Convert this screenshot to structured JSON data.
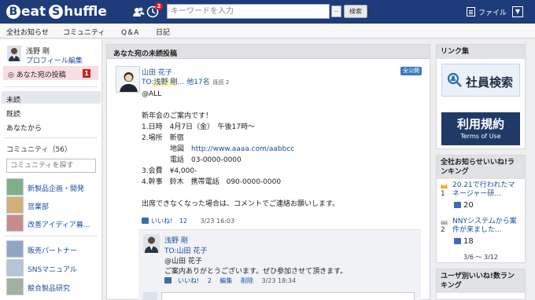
{
  "header": {
    "logo_part1": "eat",
    "logo_cap1": "B",
    "logo_cap2": "S",
    "logo_part2": "huffle",
    "notifications_count": "2",
    "search_placeholder": "キーワードを入力",
    "search_scope": "--",
    "search_button": "検索",
    "file_menu": "ファイル",
    "user_menu_arrow": "▼"
  },
  "nav": {
    "tabs": [
      "全社お知らせ",
      "コミュニティ",
      "Q＆A",
      "日記"
    ]
  },
  "sidebar": {
    "user_name": "浅野 剛",
    "profile_edit": "プロフィール編集",
    "unread_label": "◎ あなた宛の投稿",
    "unread_count": "1",
    "filters": [
      "未読",
      "既読",
      "あなたから"
    ],
    "community_heading": "コミュニティ（56）",
    "community_search_placeholder": "コミュニティを探す",
    "communities": [
      "新製品企画・開発",
      "営業部",
      "改善アイディア募...",
      "販売パートナー",
      "SNSマニュアル",
      "競合製品研究"
    ]
  },
  "main": {
    "title": "あなた宛の未読投稿",
    "post": {
      "author": "山田 花子",
      "to_prefix": "TO:",
      "to_name": "浅野 剛",
      "to_others": "… 他17名",
      "read_count": "既読 2",
      "visibility": "全公開",
      "lines": [
        "@ALL",
        "",
        "新年会のご案内です！",
        "1.日時　4月7日（金）　午後17時～",
        "2.場所　新宿",
        "　　　　地図　",
        "　　　　電話　03-0000-0000",
        "3.会費　¥4,000-",
        "4.幹事　鈴木　携帯電話　090-0000-0000",
        "",
        "出席できなくなった場合は、コメントでご連絡お願いします。"
      ],
      "map_url": "http://www.aaaa.com/aabbcc",
      "like_label": "いいね!",
      "like_count": "12",
      "date": "3/23 16:03"
    },
    "reply": {
      "author": "浅野 剛",
      "to": "TO:山田 花子",
      "lines": [
        "@山田 花子",
        "ご案内ありがとうございます。ぜひ参加させて頂きます。"
      ],
      "like_label": "いいね!",
      "like_count": "2",
      "edit": "編集",
      "delete": "削除",
      "date": "3/23 18:34"
    }
  },
  "right": {
    "links_heading": "リンク集",
    "banner1": "社員検索",
    "banner2_title": "利用規約",
    "banner2_sub": "Terms of Use",
    "ranking_heading": "全社お知らせいいね!ランキング",
    "ranking": [
      {
        "rank": "1",
        "title": "20.21で行われたマネージャー研...",
        "likes": "20"
      },
      {
        "rank": "2",
        "title": "NNYシステムから案件が来ました...",
        "likes": "18"
      }
    ],
    "ranking_period": "3/6 ～ 3/12",
    "user_ranking_heading": "ユーザ別いいね!数ランキング"
  }
}
